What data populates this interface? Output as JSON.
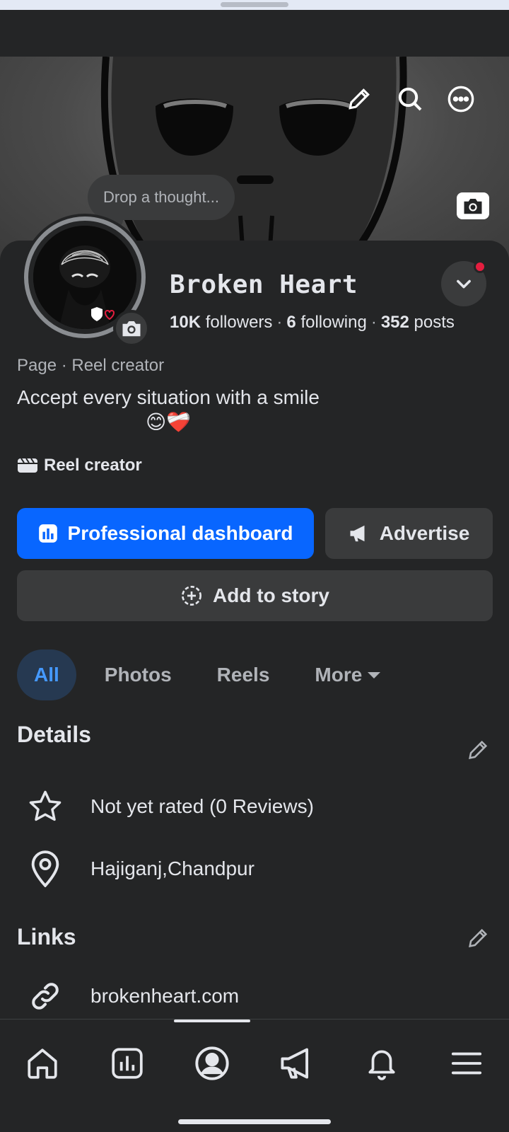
{
  "cover": {
    "thought_placeholder": "Drop a thought..."
  },
  "profile": {
    "name": "Broken Heart",
    "followers_count": "10K",
    "followers_label": "followers",
    "following_count": "6",
    "following_label": "following",
    "posts_count": "352",
    "posts_label": "posts",
    "category": "Page · Reel creator",
    "bio": "Accept every situation with a smile",
    "bio_emoji": "😊❤️‍🩹",
    "badge_label": "Reel creator"
  },
  "actions": {
    "dashboard_label": "Professional dashboard",
    "advertise_label": "Advertise",
    "story_label": "Add to story"
  },
  "tabs": [
    {
      "label": "All",
      "active": true
    },
    {
      "label": "Photos",
      "active": false
    },
    {
      "label": "Reels",
      "active": false
    },
    {
      "label": "More",
      "active": false
    }
  ],
  "details": {
    "title": "Details",
    "rating": "Not yet rated (0 Reviews)",
    "location": "Hajiganj,Chandpur"
  },
  "links": {
    "title": "Links",
    "website": "brokenheart.com"
  },
  "colors": {
    "background": "#242526",
    "primary": "#0866ff",
    "secondary_button": "#3a3b3c",
    "active_tab_bg": "#263951",
    "active_tab_text": "#4599ff",
    "notification_dot": "#e41e3f"
  },
  "bottom_nav": [
    "home-icon",
    "dashboard-icon",
    "profile-icon",
    "megaphone-icon",
    "bell-icon",
    "menu-icon"
  ]
}
